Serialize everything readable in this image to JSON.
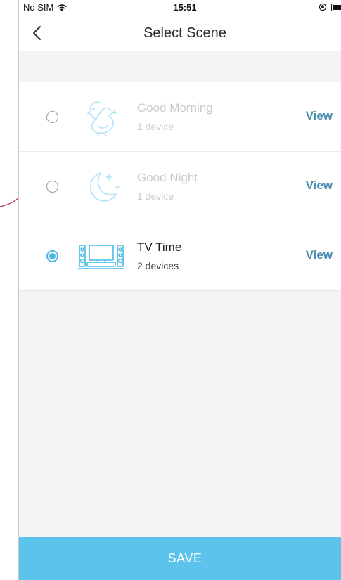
{
  "status_bar": {
    "carrier": "No SIM",
    "time": "15:51",
    "icons": [
      "wifi-icon",
      "orientation-lock-icon",
      "battery-icon"
    ]
  },
  "header": {
    "title": "Select Scene",
    "back_icon": "chevron-left-icon"
  },
  "scenes": [
    {
      "name": "Good Morning",
      "subtitle": "1 device",
      "icon": "rooster-icon",
      "selected": false,
      "dimmed": true,
      "action_label": "View"
    },
    {
      "name": "Good Night",
      "subtitle": "1 device",
      "icon": "moon-stars-icon",
      "selected": false,
      "dimmed": true,
      "action_label": "View"
    },
    {
      "name": "TV Time",
      "subtitle": "2 devices",
      "icon": "tv-speakers-icon",
      "selected": true,
      "dimmed": false,
      "action_label": "View"
    }
  ],
  "footer": {
    "save_label": "SAVE"
  },
  "colors": {
    "accent": "#5bc3ec",
    "radio_selected": "#4cb8e6",
    "link": "#4a8db0",
    "icon": "#5bc3ec"
  }
}
